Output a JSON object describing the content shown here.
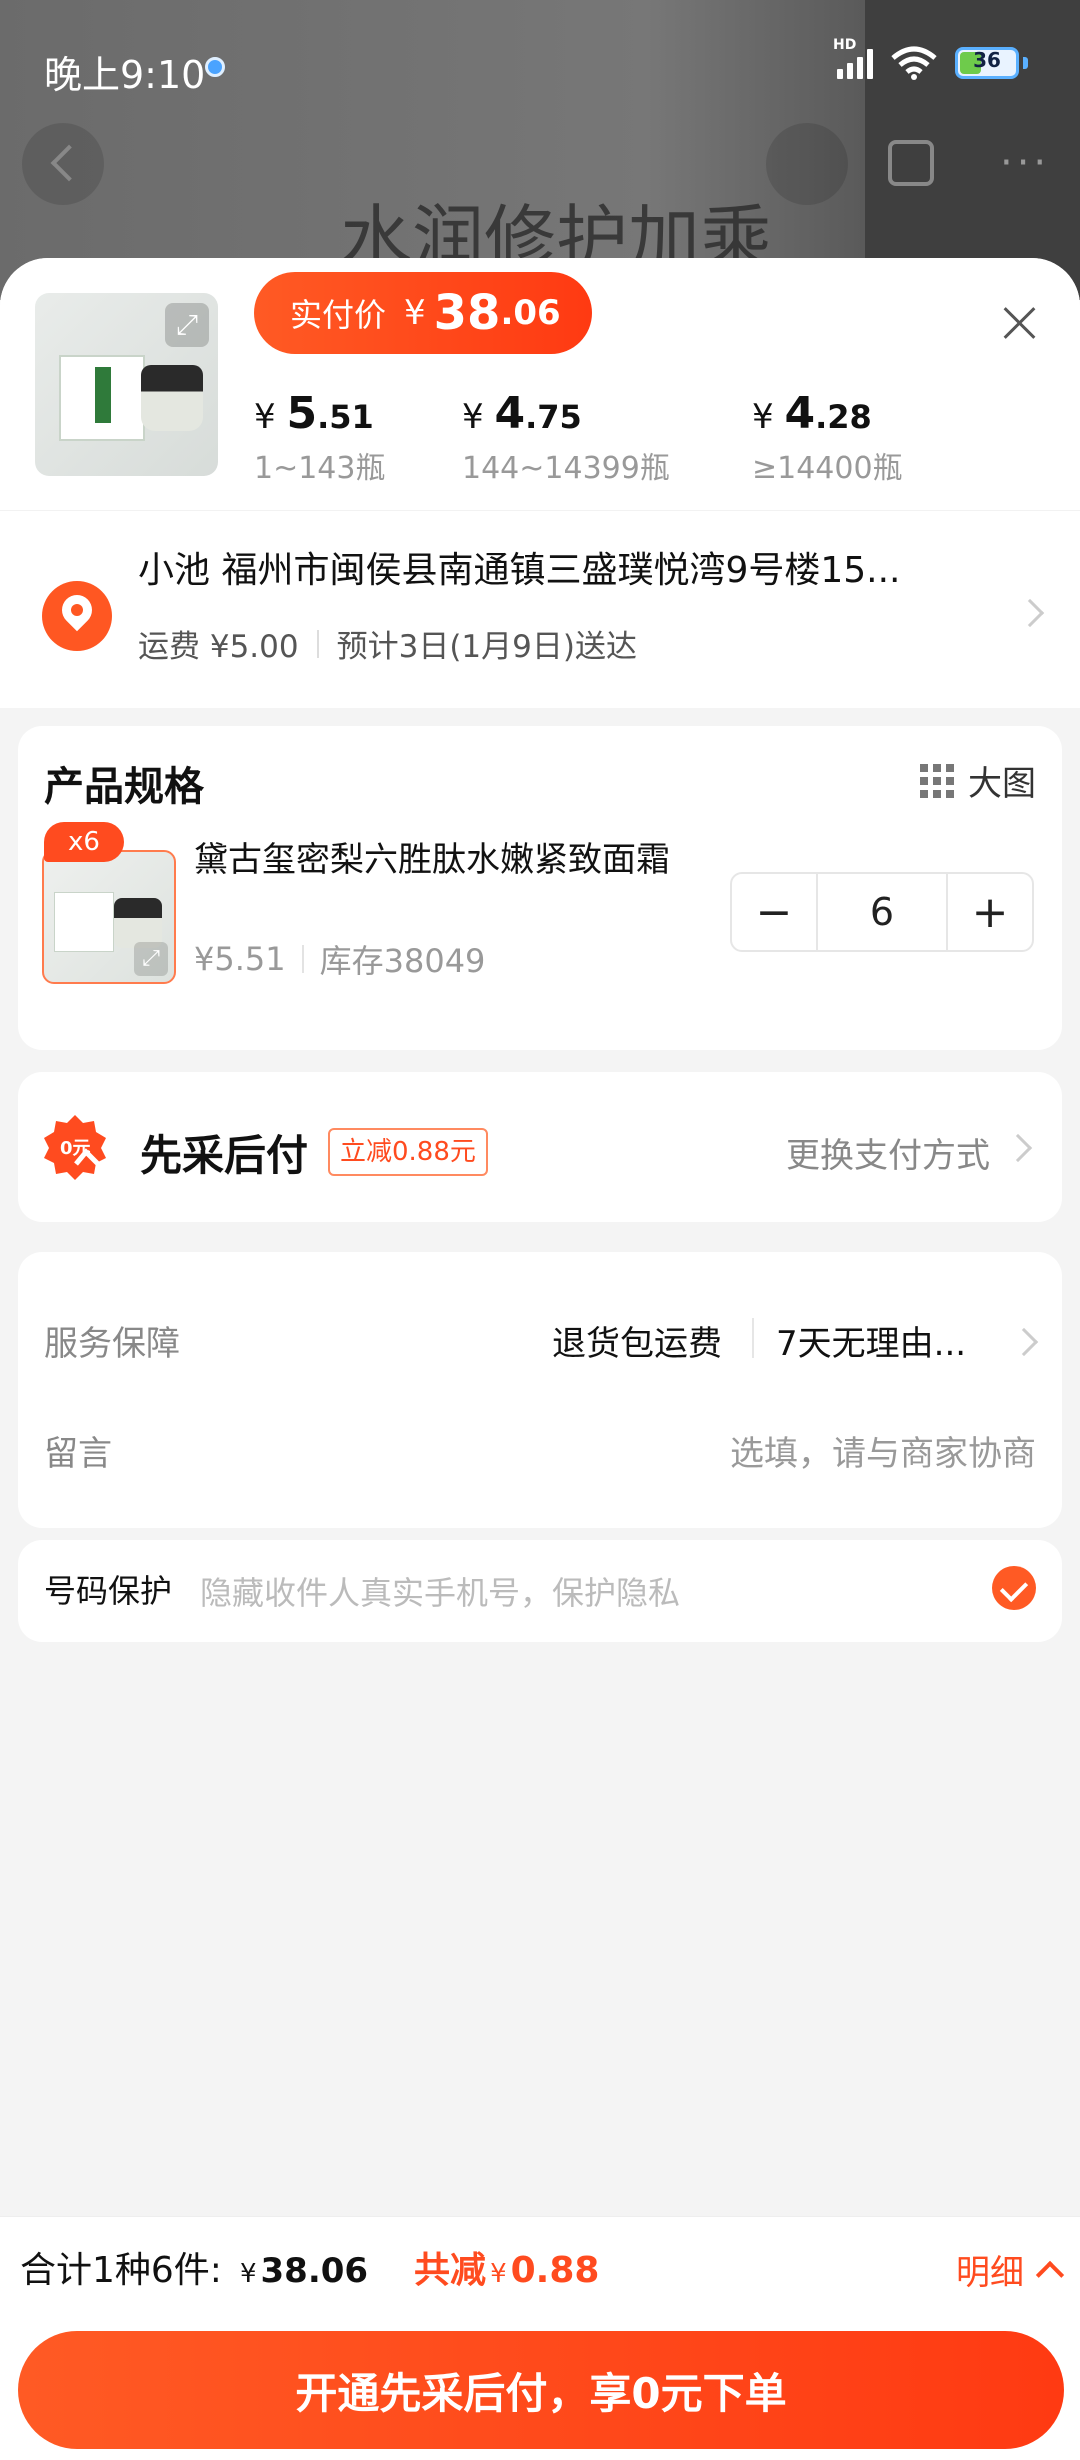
{
  "status_bar": {
    "time": "晚上9:10",
    "network": "HD",
    "battery": "36"
  },
  "background": {
    "title": "水润修护加乘"
  },
  "header": {
    "pay_label": "实付价",
    "pay_currency": "¥",
    "pay_int": "38",
    "pay_dec": ".06",
    "tiers": [
      {
        "currency": "¥",
        "int": "5",
        "dec": ".51",
        "range": "1~143瓶"
      },
      {
        "currency": "¥",
        "int": "4",
        "dec": ".75",
        "range": "144~14399瓶"
      },
      {
        "currency": "¥",
        "int": "4",
        "dec": ".28",
        "range": "≥14400瓶"
      }
    ]
  },
  "address": {
    "line": "小池 福州市闽侯县南通镇三盛璞悦湾9号楼15...",
    "shipping": "运费 ¥5.00",
    "eta": "预计3日(1月9日)送达"
  },
  "spec": {
    "title": "产品规格",
    "big_image": "大图",
    "qty_badge": "x6",
    "item_name": "黛古玺密梨六胜肽水嫩紧致面霜",
    "item_price": "¥5.51",
    "stock": "库存38049",
    "minus": "−",
    "quantity": "6",
    "plus": "+"
  },
  "bnpl": {
    "title": "先采后付",
    "tag": "立减0.88元",
    "switch": "更换支付方式",
    "icon_text": "0元"
  },
  "service": {
    "label": "服务保障",
    "value1": "退货包运费",
    "value2": "7天无理由...",
    "message_label": "留言",
    "message_placeholder": "选填，请与商家协商"
  },
  "privacy": {
    "label": "号码保护",
    "desc": "隐藏收件人真实手机号，保护隐私"
  },
  "footer": {
    "summary": "合计1种6件:",
    "currency": "¥",
    "amount": "38.06",
    "save_label": "共减",
    "save_amount": "0.88",
    "detail": "明细",
    "cta": "开通先采后付，享0元下单"
  },
  "colors": {
    "accent": "#ff4b1f",
    "accent_gradient_start": "#ff5a24"
  }
}
